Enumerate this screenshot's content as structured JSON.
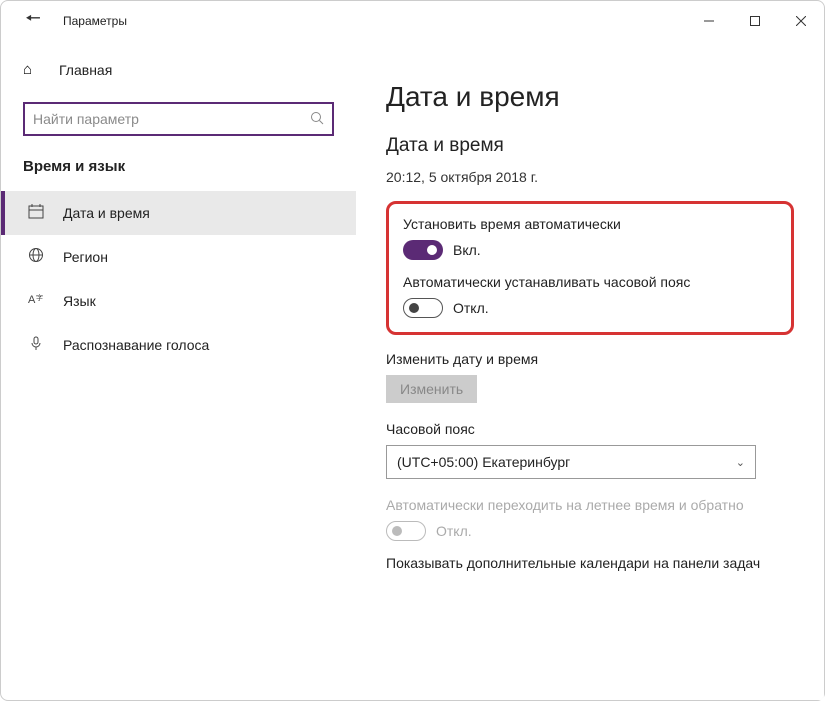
{
  "titlebar": {
    "title": "Параметры"
  },
  "sidebar": {
    "home": "Главная",
    "search_placeholder": "Найти параметр",
    "category": "Время и язык",
    "items": [
      {
        "label": "Дата и время"
      },
      {
        "label": "Регион"
      },
      {
        "label": "Язык"
      },
      {
        "label": "Распознавание голоса"
      }
    ]
  },
  "main": {
    "title": "Дата и время",
    "subtitle": "Дата и время",
    "now": "20:12, 5 октября 2018 г.",
    "auto_time": {
      "label": "Установить время автоматически",
      "state": "Вкл."
    },
    "auto_tz": {
      "label": "Автоматически устанавливать часовой пояс",
      "state": "Откл."
    },
    "change_dt": {
      "label": "Изменить дату и время",
      "button": "Изменить"
    },
    "timezone": {
      "label": "Часовой пояс",
      "value": "(UTC+05:00) Екатеринбург"
    },
    "dst": {
      "label": "Автоматически переходить на летнее время и обратно",
      "state": "Откл."
    },
    "extra_cal": {
      "label": "Показывать дополнительные календари на панели задач"
    }
  }
}
